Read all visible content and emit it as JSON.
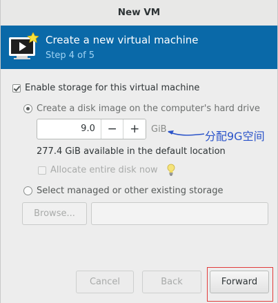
{
  "window": {
    "title": "New VM"
  },
  "banner": {
    "title": "Create a new virtual machine",
    "step": "Step 4 of 5",
    "icon": "monitor-star-icon"
  },
  "storage": {
    "enable_label": "Enable storage for this virtual machine",
    "enable_checked": true,
    "create_disk_label": "Create a disk image on the computer's hard drive",
    "create_disk_selected": true,
    "size_value": "9.0",
    "size_unit": "GiB",
    "decrement_label": "−",
    "increment_label": "+",
    "available_text": "277.4 GiB available in the default location",
    "allocate_label": "Allocate entire disk now",
    "allocate_checked": false,
    "select_existing_label": "Select managed or other existing storage",
    "select_existing_selected": false,
    "browse_label": "Browse...",
    "path_value": ""
  },
  "annotation": {
    "text": "分配9G空间",
    "color": "#2a53c9"
  },
  "footer": {
    "cancel_label": "Cancel",
    "back_label": "Back",
    "forward_label": "Forward"
  },
  "colors": {
    "banner": "#0a69a8",
    "step_text": "#9fd3f4",
    "highlight": "#e23a3a"
  }
}
